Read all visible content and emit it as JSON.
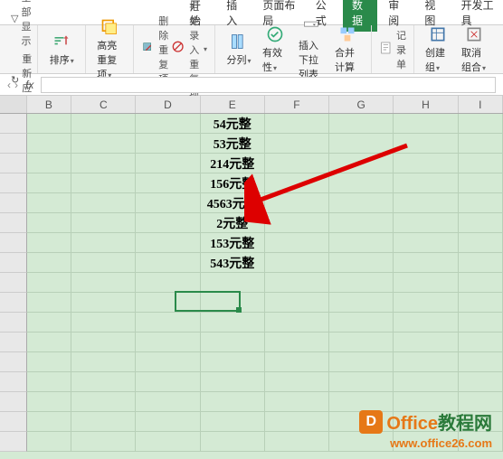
{
  "tabs": {
    "start": "开始",
    "insert": "插入",
    "layout": "页面布局",
    "formula": "公式",
    "data": "数据",
    "review": "审阅",
    "view": "视图",
    "dev": "开发工具"
  },
  "toolbar": {
    "showAll": "全部显示",
    "reapply": "重新应用",
    "sort": "排序",
    "highlight": "高亮重复项",
    "delDup": "删除重复项",
    "rejectDup": "拒绝录入重复项",
    "textToCol": "分列",
    "validation": "有效性",
    "insertDropdown": "插入下拉列表",
    "consolidate": "合并计算",
    "record": "记录单",
    "createGroup": "创建组",
    "ungroup": "取消组合"
  },
  "formulaBar": {
    "fx": "fx",
    "value": ""
  },
  "columns": [
    "B",
    "C",
    "D",
    "E",
    "F",
    "G",
    "H",
    "I"
  ],
  "cellData": {
    "E": [
      "54元整",
      "53元整",
      "214元整",
      "156元整",
      "4563元整",
      "2元整",
      "153元整",
      "543元整"
    ]
  },
  "watermark": {
    "iconLetter": "D",
    "brand1": "Office",
    "brand2": "教程网",
    "url": "www.office26.com"
  }
}
